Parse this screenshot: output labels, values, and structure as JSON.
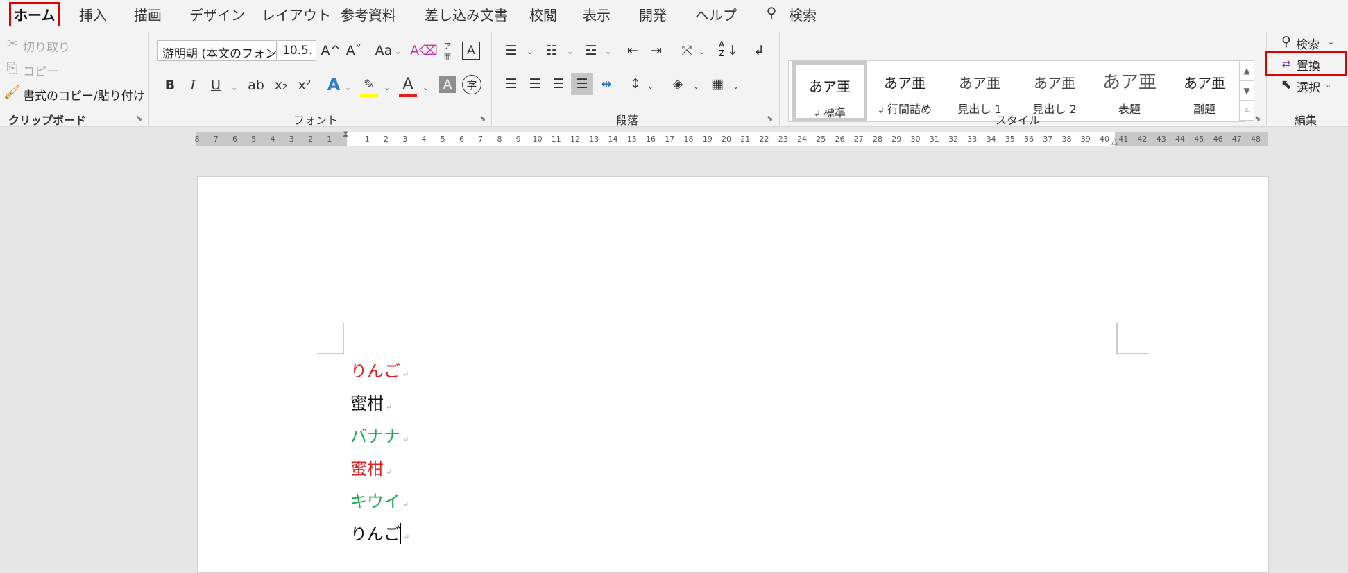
{
  "menu": {
    "tabs": [
      "ホーム",
      "挿入",
      "描画",
      "デザイン",
      "レイアウト",
      "参考資料",
      "差し込み文書",
      "校閲",
      "表示",
      "開発",
      "ヘルプ"
    ],
    "search_label": "検索"
  },
  "clipboard": {
    "cut": "切り取り",
    "copy": "コピー",
    "format_painter": "書式のコピー/貼り付け",
    "label": "クリップボード"
  },
  "font": {
    "name": "游明朝 (本文のフォント",
    "size": "10.5",
    "grow_glyph": "A^",
    "shrink_glyph": "Aˇ",
    "case_glyph": "Aa",
    "ruby_top": "ア",
    "ruby_bottom": "亜",
    "box_glyph": "A",
    "bold": "B",
    "italic": "I",
    "underline": "U",
    "strike": "ab",
    "sub": "x₂",
    "sup": "x²",
    "effect": "A",
    "color": "A",
    "shade": "A",
    "circle": "字",
    "label": "フォント"
  },
  "paragraph": {
    "label": "段落",
    "sort": "↓",
    "sort_a": "A",
    "sort_z": "Z"
  },
  "styles": {
    "label": "スタイル",
    "items": [
      {
        "preview": "あア亜",
        "name": "標準",
        "mark": "↲"
      },
      {
        "preview": "あア亜",
        "name": "行間詰め",
        "mark": "↲"
      },
      {
        "preview": "あア亜",
        "name": "見出し 1",
        "mark": ""
      },
      {
        "preview": "あア亜",
        "name": "見出し 2",
        "mark": ""
      },
      {
        "preview": "あア亜",
        "name": "表題",
        "mark": ""
      },
      {
        "preview": "あア亜",
        "name": "副題",
        "mark": ""
      }
    ]
  },
  "editing": {
    "find": "検索",
    "replace": "置換",
    "select": "選択",
    "label": "編集"
  },
  "ruler": {
    "left_ticks": [
      "8",
      "7",
      "6",
      "5",
      "4",
      "3",
      "2",
      "1"
    ],
    "right_ticks": [
      "1",
      "2",
      "3",
      "4",
      "5",
      "6",
      "7",
      "8",
      "9",
      "10",
      "11",
      "12",
      "13",
      "14",
      "15",
      "16",
      "17",
      "18",
      "19",
      "20",
      "21",
      "22",
      "23",
      "24",
      "25",
      "26",
      "27",
      "28",
      "29",
      "30",
      "31",
      "32",
      "33",
      "34",
      "35",
      "36",
      "37",
      "38",
      "39",
      "40",
      "41",
      "42",
      "43",
      "44",
      "45",
      "46",
      "47",
      "48"
    ]
  },
  "document": {
    "lines": [
      {
        "text": "りんご",
        "color": "#e02020"
      },
      {
        "text": "蜜柑",
        "color": "#111111"
      },
      {
        "text": "バナナ",
        "color": "#1aa855"
      },
      {
        "text": "蜜柑",
        "color": "#e02020"
      },
      {
        "text": "キウイ",
        "color": "#1aa855"
      },
      {
        "text": "りんご",
        "color": "#111111"
      }
    ],
    "paragraph_mark": "↵"
  },
  "colors": {
    "accent": "#2b579a",
    "highlight": "#ffff00",
    "font_color": "#e02020",
    "callout": "#e00000"
  }
}
